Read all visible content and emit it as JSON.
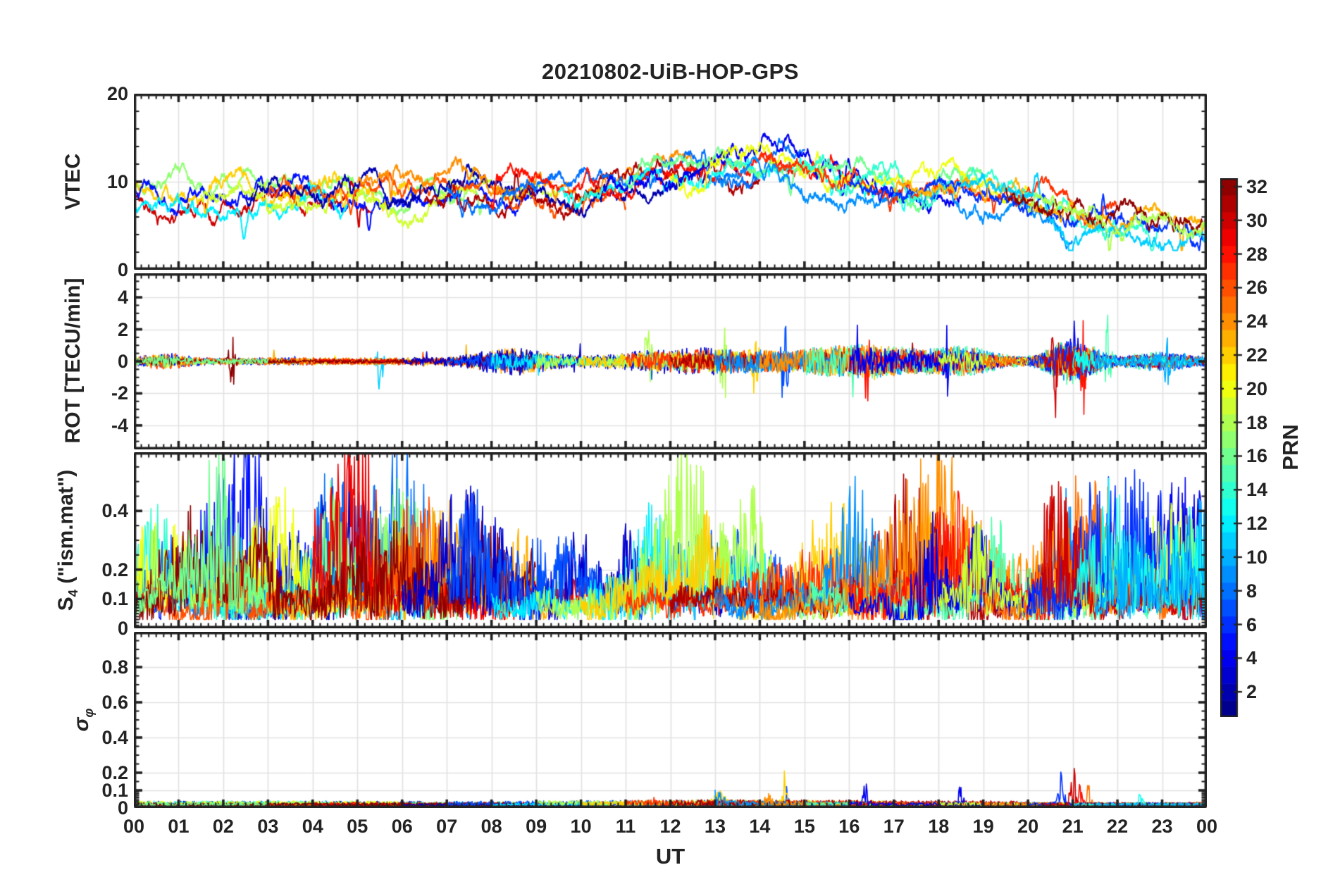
{
  "title": "20210802-UiB-HOP-GPS",
  "colors": {
    "frame": "#232323",
    "grid": "#e2e2e2",
    "background": "#ffffff"
  },
  "xaxis": {
    "label": "UT",
    "lim": [
      0,
      24
    ],
    "tick_labels": [
      "00",
      "01",
      "02",
      "03",
      "04",
      "05",
      "06",
      "07",
      "08",
      "09",
      "10",
      "11",
      "12",
      "13",
      "14",
      "15",
      "16",
      "17",
      "18",
      "19",
      "20",
      "21",
      "22",
      "23",
      "00"
    ],
    "minor_per_hour": 6
  },
  "colorbar": {
    "label": "PRN",
    "colormap": "jet",
    "levels": 32,
    "range": [
      1,
      32
    ],
    "tick_values": [
      2,
      4,
      6,
      8,
      10,
      12,
      14,
      16,
      18,
      20,
      22,
      24,
      26,
      28,
      30,
      32
    ]
  },
  "chart_data": [
    {
      "type": "line",
      "name": "VTEC",
      "ylabel": "VTEC",
      "ylim": [
        0,
        20
      ],
      "yticks": [
        0,
        10,
        20
      ],
      "ytick_labels": [
        "0",
        "10",
        "20"
      ],
      "y_minor_step": 2,
      "description": "Vertical TEC per GPS satellite arc, ~8-10 TECU through the night, broad peak ~12-16 TECU near 13-15 UT, decline to ~5-7 TECU after 20 UT",
      "series": [
        [
          0,
          5.3,
          30,
          -0.5
        ],
        [
          0,
          7.8,
          17,
          0.3
        ],
        [
          0,
          6.2,
          22,
          0.4
        ],
        [
          0,
          9,
          5,
          -0.2
        ],
        [
          0,
          4.8,
          12,
          -0.6
        ],
        [
          1.5,
          9.5,
          19,
          -0.4
        ],
        [
          3,
          11,
          26,
          0.2
        ],
        [
          2.5,
          13.5,
          2,
          0.0
        ],
        [
          5,
          12.5,
          24,
          0.5
        ],
        [
          6.5,
          14,
          31,
          -0.3
        ],
        [
          7,
          15,
          8,
          0.3
        ],
        [
          8,
          16,
          28,
          0.4
        ],
        [
          9.5,
          17.5,
          13,
          0.1
        ],
        [
          10.5,
          18.5,
          4,
          -0.2
        ],
        [
          11,
          19,
          16,
          0.3
        ],
        [
          12,
          20,
          20,
          0.1
        ],
        [
          13,
          21,
          9,
          -0.3
        ],
        [
          14,
          22,
          27,
          0.2
        ],
        [
          15,
          23,
          14,
          0.4
        ],
        [
          16,
          24,
          6,
          -0.3
        ],
        [
          17,
          24,
          23,
          0.2
        ],
        [
          18.5,
          24,
          11,
          0.0
        ],
        [
          19.5,
          24,
          32,
          0.3
        ],
        [
          20,
          24,
          18,
          -0.4
        ]
      ],
      "envelope": {
        "base": 8.6,
        "peak_amp": 3.3,
        "peak_t": 14.1,
        "peak_w": 2.4,
        "decline_after": 19.3,
        "decline_rate": 1.35
      }
    },
    {
      "type": "line",
      "name": "ROT",
      "ylabel": "ROT [TECU/min]",
      "ylim": [
        -5.5,
        5.5
      ],
      "yticks": [
        -4,
        -2,
        0,
        2,
        4
      ],
      "ytick_labels": [
        "-4",
        "-2",
        "0",
        "2",
        "4"
      ],
      "y_minor_step": 0.5,
      "description": "Rate of TEC change, noise band around 0 with bursts up to +/-4.5 TECU/min near 14.5 UT and 20.5-21.5 UT"
    },
    {
      "type": "line",
      "name": "S4",
      "ylabel_main": "S",
      "ylabel_sub": "4",
      "ylabel_suffix": " (\"ism.mat\")",
      "ylim": [
        0,
        0.6
      ],
      "yticks": [
        0,
        0.1,
        0.2,
        0.4
      ],
      "ytick_labels": [
        "0",
        "0.1",
        "0.2",
        "0.4"
      ],
      "y_minor_step": 0.05,
      "y_minor_dense_below": 0.1,
      "y_minor_dense_step": 0.01,
      "description": "Amplitude scintillation index, baseline 0.05-0.12 with continuous spiky enhancements reaching 0.4-0.6 throughout the day"
    },
    {
      "type": "line",
      "name": "sigma_phi",
      "ylabel_main": "σ",
      "ylabel_sub": "φ",
      "ylim": [
        0,
        1.0
      ],
      "yticks": [
        0,
        0.1,
        0.2,
        0.4,
        0.6,
        0.8
      ],
      "ytick_labels": [
        "0",
        "0.1",
        "0.2",
        "0.4",
        "0.6",
        "0.8"
      ],
      "y_minor_step": 0.05,
      "y_minor_dense_below": 0.1,
      "y_minor_dense_step": 0.01,
      "description": "Phase scintillation index, near 0.02-0.05 baseline with isolated spikes ~0.2 at 14.5/16.3/18.5 UT and up to ~0.3 at 20.7-21.3 UT"
    }
  ],
  "passes": [
    [
      0,
      6.5,
      2
    ],
    [
      0,
      4,
      5
    ],
    [
      0,
      7.5,
      8
    ],
    [
      1,
      8,
      11
    ],
    [
      0,
      5,
      14
    ],
    [
      2,
      9.5,
      17
    ],
    [
      0,
      6,
      20
    ],
    [
      3,
      10,
      23
    ],
    [
      0,
      8.5,
      26
    ],
    [
      4,
      11,
      29
    ],
    [
      0,
      9,
      32
    ],
    [
      6,
      13.5,
      3
    ],
    [
      7,
      15,
      7
    ],
    [
      8,
      16,
      12
    ],
    [
      9,
      17,
      18
    ],
    [
      10,
      18,
      22
    ],
    [
      11,
      19,
      27
    ],
    [
      12,
      20,
      31
    ],
    [
      13,
      21,
      9
    ],
    [
      14,
      22,
      24
    ],
    [
      15,
      23,
      15
    ],
    [
      16,
      24,
      28
    ],
    [
      16,
      24,
      4
    ],
    [
      18,
      24,
      19
    ],
    [
      19,
      24,
      25
    ],
    [
      20,
      24,
      6
    ],
    [
      20.3,
      24,
      30
    ],
    [
      21,
      24,
      13
    ],
    [
      0,
      3,
      16
    ],
    [
      21.5,
      24,
      10
    ]
  ],
  "rot_activity": [
    [
      0.7,
      0.5,
      0.3
    ],
    [
      8.5,
      0.9,
      0.55
    ],
    [
      12.8,
      2.2,
      0.5
    ],
    [
      16.4,
      1.6,
      0.7
    ],
    [
      18.6,
      0.8,
      0.5
    ],
    [
      21,
      0.6,
      1.1
    ],
    [
      23,
      0.8,
      0.35
    ]
  ],
  "rot_events": [
    [
      2.2,
      32,
      1.6
    ],
    [
      5.5,
      11,
      1.8
    ],
    [
      8.4,
      26,
      1.2
    ],
    [
      11.5,
      18,
      2.6
    ],
    [
      13.2,
      18,
      2.2
    ],
    [
      13.9,
      22,
      2.0
    ],
    [
      14.55,
      7,
      3.8
    ],
    [
      15.15,
      7,
      3.0
    ],
    [
      16.4,
      28,
      1.6
    ],
    [
      18.2,
      4,
      1.5
    ],
    [
      20.6,
      30,
      3.6
    ],
    [
      21.0,
      4,
      3.4
    ],
    [
      21.25,
      28,
      3.0
    ],
    [
      21.8,
      15,
      2.8
    ],
    [
      23.1,
      10,
      1.1
    ]
  ],
  "s4_events": [
    [
      1.3,
      32,
      0.3,
      0.9
    ],
    [
      9.7,
      32,
      0.38,
      0.7
    ],
    [
      4.9,
      29,
      0.3,
      0.5
    ],
    [
      2.1,
      26,
      0.25,
      0.4
    ],
    [
      2.7,
      5,
      0.3,
      0.4
    ],
    [
      4.3,
      8,
      0.33,
      0.5
    ],
    [
      5.9,
      12,
      0.33,
      0.3
    ],
    [
      7.6,
      7,
      0.35,
      0.4
    ],
    [
      11.1,
      3,
      0.3,
      0.25
    ],
    [
      13.8,
      18,
      0.3,
      0.4
    ],
    [
      12.9,
      22,
      0.28,
      0.4
    ],
    [
      16.1,
      9,
      0.3,
      0.5
    ],
    [
      18.3,
      28,
      0.35,
      0.5
    ],
    [
      20.6,
      24,
      0.3,
      0.7
    ],
    [
      19.2,
      15,
      0.3,
      0.5
    ],
    [
      22.4,
      10,
      0.32,
      0.4
    ],
    [
      21.9,
      13,
      0.28,
      0.4
    ],
    [
      18.9,
      4,
      0.25,
      0.4
    ]
  ],
  "sigma_events": [
    [
      11.6,
      27,
      0.05,
      0.05
    ],
    [
      13.0,
      9,
      0.07,
      0.2
    ],
    [
      14.2,
      24,
      0.05,
      0.1
    ],
    [
      14.55,
      22,
      0.17,
      0.06
    ],
    [
      14.6,
      7,
      0.1,
      0.05
    ],
    [
      16.35,
      4,
      0.16,
      0.07
    ],
    [
      18.5,
      4,
      0.13,
      0.06
    ],
    [
      13.1,
      22,
      0.06,
      0.15
    ],
    [
      20.75,
      6,
      0.18,
      0.08
    ],
    [
      21.0,
      30,
      0.27,
      0.07
    ],
    [
      21.15,
      28,
      0.22,
      0.06
    ],
    [
      21.35,
      25,
      0.12,
      0.06
    ],
    [
      22.5,
      13,
      0.05,
      0.08
    ]
  ]
}
